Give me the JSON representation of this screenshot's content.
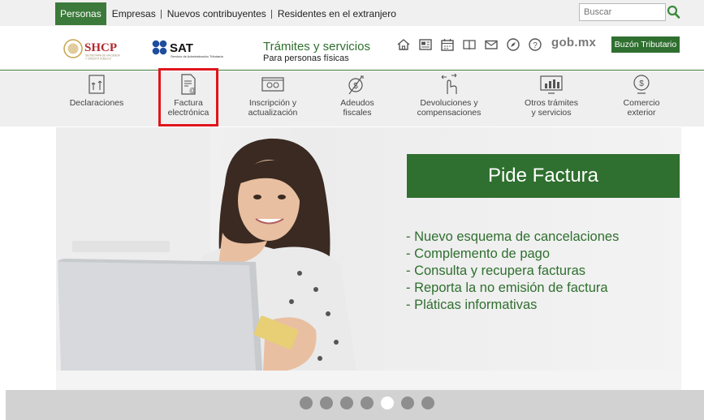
{
  "topbar": {
    "tabs": [
      {
        "label": "Personas",
        "active": true
      },
      {
        "label": "Empresas"
      },
      {
        "label": "Nuevos contribuyentes"
      },
      {
        "label": "Residentes en el extranjero"
      }
    ],
    "search": {
      "placeholder": "Buscar"
    }
  },
  "header": {
    "logos": {
      "shcp": "SHCP",
      "shcp_sub": "SECRETARÍA DE HACIENDA Y CRÉDITO PÚBLICO",
      "sat": "SAT",
      "sat_sub": "Servicio de Administración Tributaria"
    },
    "title": "Trámites y servicios",
    "subtitle": "Para personas físicas",
    "icons": [
      "home-icon",
      "news-icon",
      "calendar-icon",
      "book-icon",
      "mail-icon",
      "compass-icon",
      "help-icon"
    ],
    "gobmx": "gob.mx",
    "buzon_label": "Buzón Tributario"
  },
  "nav": {
    "items": [
      {
        "line1": "Declaraciones",
        "line2": "",
        "icon": "declaraciones-icon"
      },
      {
        "line1": "Factura",
        "line2": "electrónica",
        "icon": "factura-icon"
      },
      {
        "line1": "Inscripción y",
        "line2": "actualización",
        "icon": "inscripcion-icon"
      },
      {
        "line1": "Adeudos",
        "line2": "fiscales",
        "icon": "adeudos-icon"
      },
      {
        "line1": "Devoluciones y",
        "line2": "compensaciones",
        "icon": "devoluciones-icon"
      },
      {
        "line1": "Otros trámites",
        "line2": "y servicios",
        "icon": "otros-tramites-icon"
      },
      {
        "line1": "Comercio",
        "line2": "exterior",
        "icon": "comercio-icon"
      }
    ]
  },
  "hero": {
    "title": "Pide Factura",
    "list": [
      "- Nuevo esquema de cancelaciones",
      "- Complemento de pago",
      "- Consulta y recupera facturas",
      "- Reporta la no emisión de factura",
      "- Pláticas informativas"
    ]
  },
  "slider": {
    "count": 7,
    "active_index": 4
  },
  "colors": {
    "brand_green": "#2f6f2f",
    "tab_green": "#3c7a3b",
    "highlight_red": "#e0151c"
  }
}
